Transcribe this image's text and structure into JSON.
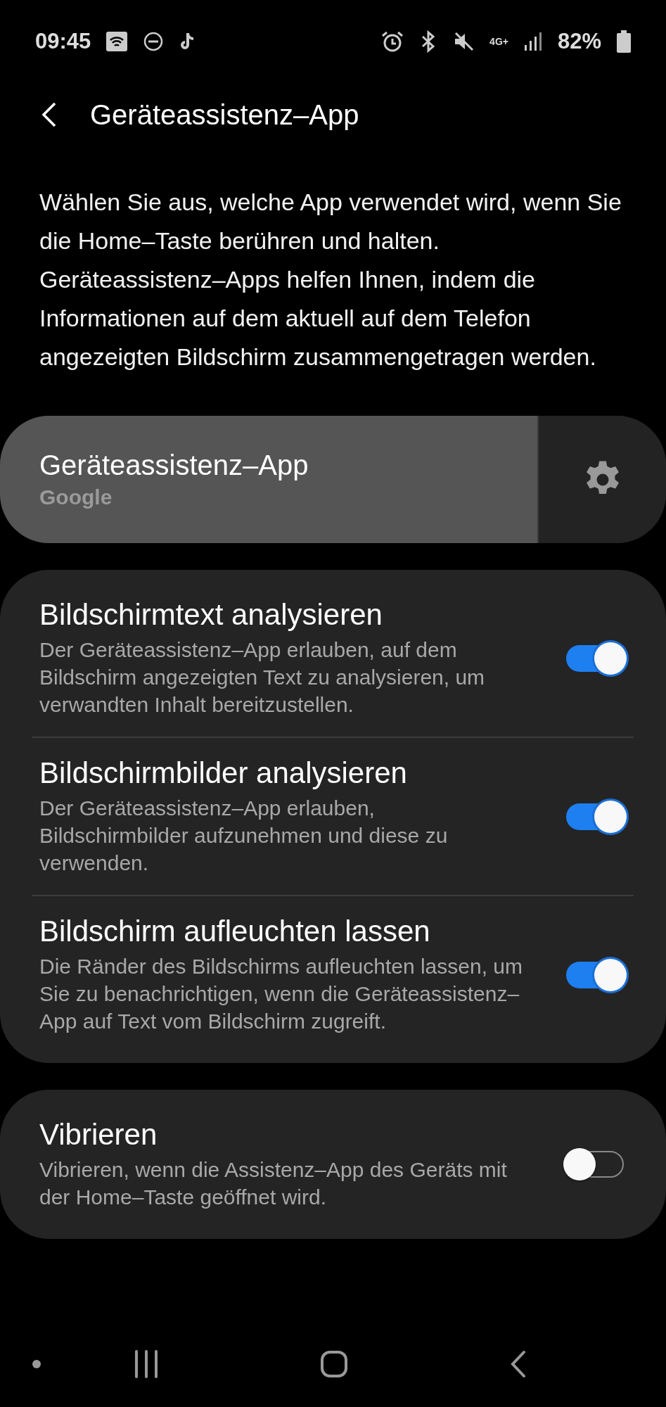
{
  "status_bar": {
    "time": "09:45",
    "network": "4G+",
    "battery": "82%"
  },
  "header": {
    "title": "Geräteassistenz–App"
  },
  "description": "Wählen Sie aus, welche App verwendet wird, wenn Sie die Home–Taste berühren und halten. Geräteassistenz–Apps helfen Ihnen, indem die Informationen auf dem aktuell auf dem Telefon angezeigten Bildschirm zusammengetragen werden.",
  "assistant_app": {
    "title": "Geräteassistenz–App",
    "value": "Google"
  },
  "sections": [
    {
      "items": [
        {
          "title": "Bildschirmtext analysieren",
          "description": "Der Geräteassistenz–App erlauben, auf dem Bildschirm angezeigten Text zu analysieren, um verwandten Inhalt bereitzustellen.",
          "on": true
        },
        {
          "title": "Bildschirmbilder analysieren",
          "description": "Der Geräteassistenz–App erlauben, Bildschirmbilder aufzunehmen und diese zu verwenden.",
          "on": true
        },
        {
          "title": "Bildschirm aufleuchten lassen",
          "description": "Die Ränder des Bildschirms aufleuchten lassen, um Sie zu benachrichtigen, wenn die Geräteassistenz–App auf Text vom Bildschirm zugreift.",
          "on": true
        }
      ]
    },
    {
      "items": [
        {
          "title": "Vibrieren",
          "description": "Vibrieren, wenn die Assistenz–App des Geräts mit der Home–Taste geöffnet wird.",
          "on": false
        }
      ]
    }
  ]
}
